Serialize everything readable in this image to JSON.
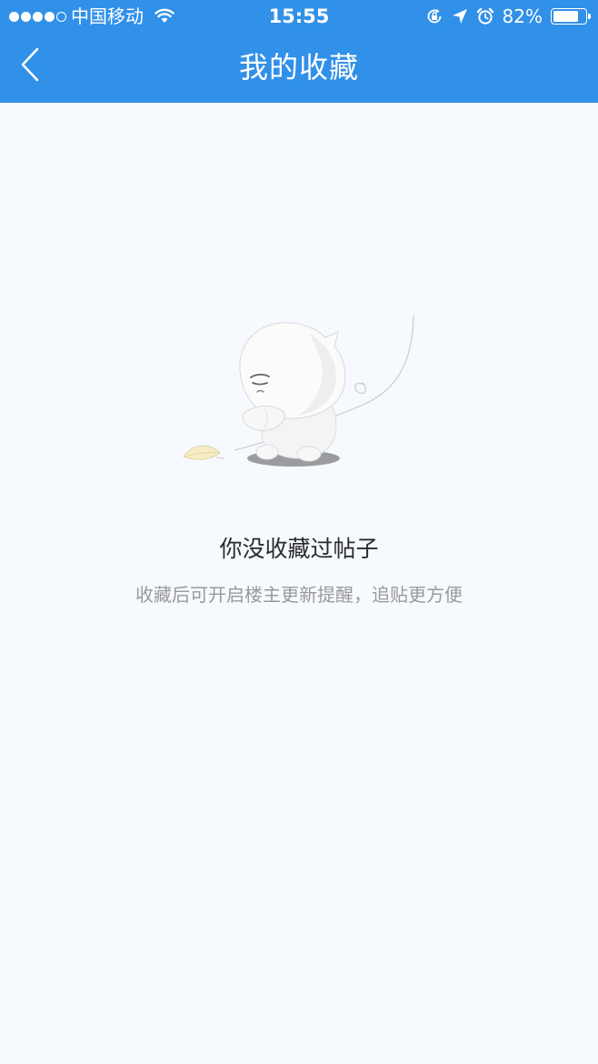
{
  "status_bar": {
    "carrier": "中国移动",
    "time": "15:55",
    "battery_percent": "82%",
    "battery_level": 0.82,
    "signal_strength": 4,
    "signal_max": 5
  },
  "nav": {
    "title": "我的收藏",
    "back_icon": "chevron-left-icon"
  },
  "empty_state": {
    "title": "你没收藏过帖子",
    "subtitle": "收藏后可开启楼主更新提醒，追贴更方便",
    "illustration": "sad-mascot-illustration"
  },
  "colors": {
    "header": "#3190e8",
    "background": "#f6f9fe",
    "title_text": "#2b2b2b",
    "subtitle_text": "#9a9a9a"
  }
}
